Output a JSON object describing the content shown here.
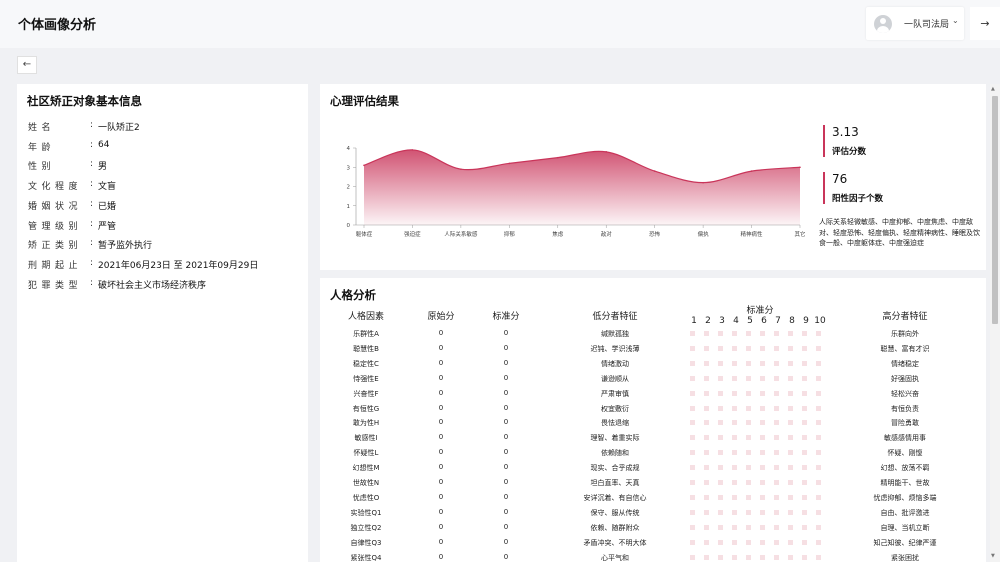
{
  "header": {
    "title": "个体画像分析",
    "user_name": "一队司法局",
    "chevron": "⌄",
    "logout_icon": "→",
    "back_icon": "←"
  },
  "basic_info": {
    "title": "社区矫正对象基本信息",
    "rows": [
      {
        "label": "姓名",
        "value": "一队矫正2"
      },
      {
        "label": "年龄",
        "value": "64"
      },
      {
        "label": "性别",
        "value": "男"
      },
      {
        "label": "文化程度",
        "value": "文盲"
      },
      {
        "label": "婚姻状况",
        "value": "已婚"
      },
      {
        "label": "管理级别",
        "value": "严管"
      },
      {
        "label": "矫正类别",
        "value": "暂予监外执行"
      },
      {
        "label": "刑期起止",
        "value": "2021年06月23日 至 2021年09月29日"
      },
      {
        "label": "犯罪类型",
        "value": "破坏社会主义市场经济秩序"
      }
    ]
  },
  "psych": {
    "title": "心理评估结果",
    "score_value": "3.13",
    "score_label": "评估分数",
    "factor_value": "76",
    "factor_label": "阳性因子个数",
    "description": "人际关系轻微敏感、中度抑郁、中度焦虑、中度敌对、轻度恐怖、轻度偏执、轻度精神病性、睡眠及饮食一般、中度躯体症、中度强迫症",
    "accent_color": "#c9355a"
  },
  "chart_data": {
    "type": "area",
    "categories": [
      "躯体症",
      "强迫症",
      "人际关系敏感",
      "抑郁",
      "焦虑",
      "敌对",
      "恐怖",
      "偏执",
      "精神病性",
      "其它"
    ],
    "values": [
      3.1,
      3.9,
      2.9,
      3.2,
      3.5,
      3.8,
      2.8,
      2.2,
      2.8,
      3.0
    ],
    "yticks": [
      "0",
      "1",
      "2",
      "3",
      "4"
    ],
    "ylim": [
      0,
      4
    ],
    "color": "#c9355a"
  },
  "personality": {
    "title": "人格分析",
    "col_factor": "人格因素",
    "col_raw": "原始分",
    "col_std": "标准分",
    "col_low": "低分者特征",
    "col_scale": "标准分",
    "col_high": "高分者特征",
    "scale": [
      "1",
      "2",
      "3",
      "4",
      "5",
      "6",
      "7",
      "8",
      "9",
      "10"
    ],
    "rows": [
      {
        "factor": "乐群性A",
        "raw": "0",
        "std": "0",
        "low": "缄默孤独",
        "high": "乐群向外"
      },
      {
        "factor": "聪慧性B",
        "raw": "0",
        "std": "0",
        "low": "迟钝、学识浅薄",
        "high": "聪慧、富有才识"
      },
      {
        "factor": "稳定性C",
        "raw": "0",
        "std": "0",
        "low": "情绪激动",
        "high": "情绪稳定"
      },
      {
        "factor": "恃强性E",
        "raw": "0",
        "std": "0",
        "low": "谦逊顺从",
        "high": "好强固执"
      },
      {
        "factor": "兴奋性F",
        "raw": "0",
        "std": "0",
        "low": "严肃审慎",
        "high": "轻松兴奋"
      },
      {
        "factor": "有恒性G",
        "raw": "0",
        "std": "0",
        "low": "权宜敷衍",
        "high": "有恒负责"
      },
      {
        "factor": "敢为性H",
        "raw": "0",
        "std": "0",
        "low": "畏怯退缩",
        "high": "冒险勇敢"
      },
      {
        "factor": "敏感性I",
        "raw": "0",
        "std": "0",
        "low": "理智、着重实际",
        "high": "敏感感情用事"
      },
      {
        "factor": "怀疑性L",
        "raw": "0",
        "std": "0",
        "low": "依赖随和",
        "high": "怀疑、刚愎"
      },
      {
        "factor": "幻想性M",
        "raw": "0",
        "std": "0",
        "low": "现实、合乎成规",
        "high": "幻想、放荡不羁"
      },
      {
        "factor": "世故性N",
        "raw": "0",
        "std": "0",
        "low": "坦白直率、天真",
        "high": "精明能干、世故"
      },
      {
        "factor": "忧虑性O",
        "raw": "0",
        "std": "0",
        "low": "安详沉着、有自信心",
        "high": "忧虑抑郁、烦恼多端"
      },
      {
        "factor": "实验性Q1",
        "raw": "0",
        "std": "0",
        "low": "保守、服从传统",
        "high": "自由、批评激进"
      },
      {
        "factor": "独立性Q2",
        "raw": "0",
        "std": "0",
        "low": "依赖、随群附众",
        "high": "自理、当机立断"
      },
      {
        "factor": "自律性Q3",
        "raw": "0",
        "std": "0",
        "low": "矛盾冲突、不明大体",
        "high": "知己知彼、纪律严谨"
      },
      {
        "factor": "紧张性Q4",
        "raw": "0",
        "std": "0",
        "low": "心平气和",
        "high": "紧张困扰"
      }
    ],
    "dot_color": "#f6dfe3"
  }
}
